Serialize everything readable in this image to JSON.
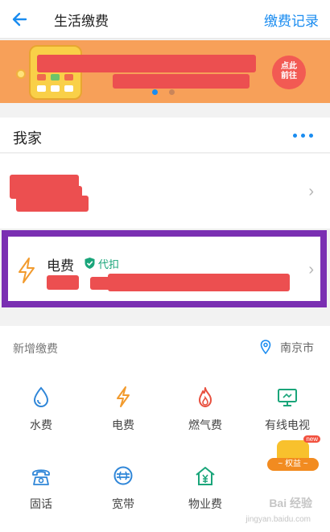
{
  "header": {
    "title": "生活缴费",
    "records_label": "缴费记录",
    "back_icon": "arrow-left-icon"
  },
  "banner": {
    "button_label_line1": "点此",
    "button_label_line2": "前往",
    "background": "#f7a059",
    "page_dots": 2,
    "active_dot": 1
  },
  "home": {
    "title": "我家",
    "more_icon": "more-dots-icon"
  },
  "accounts": [
    {
      "name": "",
      "redacted": true
    },
    {
      "name": "电费",
      "badge": "代扣",
      "icon": "lightning-icon",
      "redacted_detail": true,
      "highlighted": true
    }
  ],
  "new_payment": {
    "title": "新增缴费",
    "city": "南京市",
    "location_icon": "location-pin-icon"
  },
  "services": [
    {
      "label": "水费",
      "icon": "water-drop-icon"
    },
    {
      "label": "电费",
      "icon": "lightning-icon"
    },
    {
      "label": "燃气费",
      "icon": "flame-icon"
    },
    {
      "label": "有线电视",
      "icon": "tv-icon"
    },
    {
      "label": "固话",
      "icon": "telephone-icon"
    },
    {
      "label": "宽带",
      "icon": "broadband-icon"
    },
    {
      "label": "物业费",
      "icon": "property-house-icon"
    }
  ],
  "promo": {
    "ribbon_label": "~ 权益 ~",
    "new_tag": "new"
  },
  "watermark": {
    "brand": "Bai 经验",
    "url": "jingyan.baidu.com"
  },
  "colors": {
    "accent": "#1a8cf0",
    "highlight_border": "#7a2fb2",
    "redaction": "#ec4f50",
    "badge_green": "#1aa57a"
  }
}
